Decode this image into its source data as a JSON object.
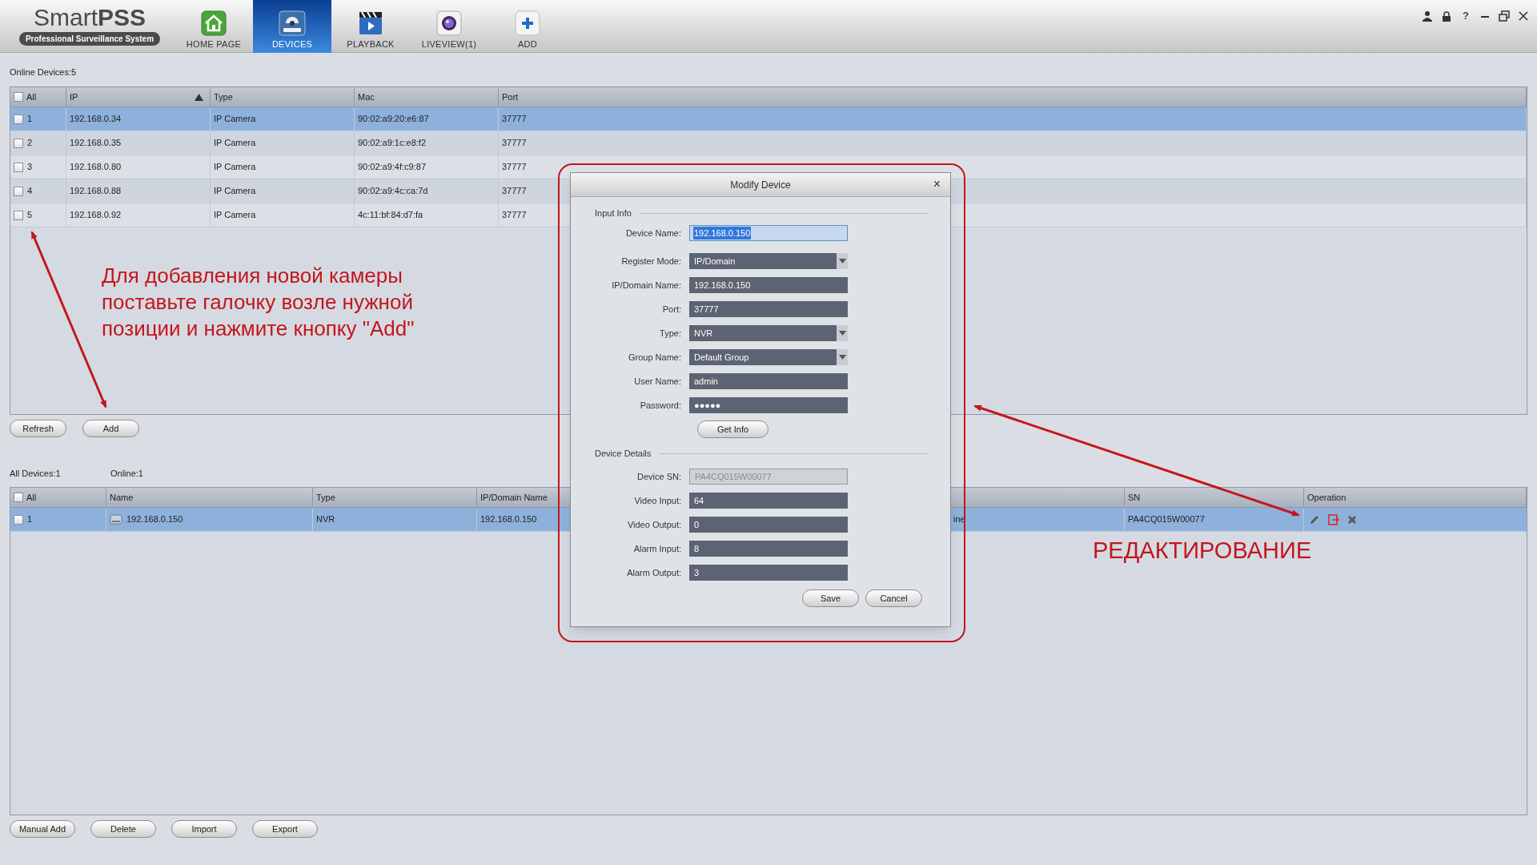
{
  "app": {
    "logo": "Smart**PSS**",
    "subtitle": "Professional Surveillance System",
    "help_button": "?"
  },
  "nav_tabs": [
    {
      "label": "HOME PAGE",
      "kind": "home",
      "selected": false
    },
    {
      "label": "DEVICES",
      "kind": "devices",
      "selected": true
    },
    {
      "label": "PLAYBACK",
      "kind": "playback",
      "selected": false
    },
    {
      "label": "LIVEVIEW(1)",
      "kind": "liveview",
      "selected": false
    },
    {
      "label": "ADD",
      "kind": "add",
      "selected": false
    }
  ],
  "online_devices": {
    "title": "Online Devices:5",
    "all_checked": false,
    "columns": [
      {
        "label": "All",
        "sorted": false
      },
      {
        "label": "IP",
        "sorted": true
      },
      {
        "label": "Type",
        "sorted": false
      },
      {
        "label": "Mac",
        "sorted": false
      },
      {
        "label": "Port",
        "sorted": false
      }
    ],
    "rows": [
      {
        "cells": [
          "1",
          "192.168.0.34",
          "IP Camera",
          "90:02:a9:20:e6:87",
          "37777"
        ],
        "checked": false,
        "selected": true
      },
      {
        "cells": [
          "2",
          "192.168.0.35",
          "IP Camera",
          "90:02:a9:1c:e8:f2",
          "37777"
        ],
        "checked": false,
        "selected": false
      },
      {
        "cells": [
          "3",
          "192.168.0.80",
          "IP Camera",
          "90:02:a9:4f:c9:87",
          "37777"
        ],
        "checked": false,
        "selected": false
      },
      {
        "cells": [
          "4",
          "192.168.0.88",
          "IP Camera",
          "90:02:a9:4c:ca:7d",
          "37777"
        ],
        "checked": false,
        "selected": false
      },
      {
        "cells": [
          "5",
          "192.168.0.92",
          "IP Camera",
          "4c:11:bf:84:d7:fa",
          "37777"
        ],
        "checked": false,
        "selected": false
      }
    ],
    "buttons": [
      "Refresh",
      "Add"
    ]
  },
  "all_devices": {
    "title": "All Devices:1",
    "online": "Online:1",
    "all_checked": false,
    "columns": [
      {
        "label": "All"
      },
      {
        "label": "Name"
      },
      {
        "label": "Type"
      },
      {
        "label": "IP/Domain Name"
      },
      {},
      {
        "label": "SN"
      },
      {
        "label": "Operation"
      }
    ],
    "rows": [
      {
        "cells": [
          "1",
          "192.168.0.150",
          "NVR",
          "192.168.0.150",
          "ine",
          "PA4CQ015W00077"
        ],
        "checked": false,
        "selected": true
      }
    ],
    "buttons": [
      "Manual Add",
      "Delete",
      "Import",
      "Export"
    ]
  },
  "dialog": {
    "title": "Modify Device",
    "close": "×",
    "input_info": {
      "title": "Input Info",
      "fields": [
        {
          "label": "Device Name:",
          "value": "192.168.0.150",
          "kind": "text",
          "focused": true
        },
        {
          "label": "Register Mode:",
          "value": "IP/Domain",
          "kind": "select",
          "focused": false
        },
        {
          "label": "IP/Domain Name:",
          "value": "192.168.0.150",
          "kind": "text",
          "focused": false
        },
        {
          "label": "Port:",
          "value": "37777",
          "kind": "text",
          "focused": false
        },
        {
          "label": "Type:",
          "value": "NVR",
          "kind": "select",
          "focused": false
        },
        {
          "label": "Group Name:",
          "value": "Default Group",
          "kind": "select",
          "focused": false
        },
        {
          "label": "User Name:",
          "value": "admin",
          "kind": "text",
          "focused": false
        },
        {
          "label": "Password:",
          "value": "●●●●●",
          "kind": "text",
          "focused": false
        }
      ]
    },
    "get_info_button": "Get Info",
    "device_details": {
      "title": "Device Details",
      "fields": [
        {
          "label": "Device SN:",
          "value": "PA4CQ015W00077",
          "kind": "readonly",
          "focused": false
        },
        {
          "label": "Video Input:",
          "value": "64",
          "kind": "text",
          "focused": false
        },
        {
          "label": "Video Output:",
          "value": "0",
          "kind": "text",
          "focused": false
        },
        {
          "label": "Alarm Input:",
          "value": "8",
          "kind": "text",
          "focused": false
        },
        {
          "label": "Alarm Output:",
          "value": "3",
          "kind": "text",
          "focused": false
        }
      ]
    },
    "buttons": [
      "Save",
      "Cancel"
    ]
  },
  "annotations": {
    "add_hint": "Для добавления новой камеры\nпоставьте галочку возле нужной\nпозиции и нажмите кнопку \"Add\"",
    "edit_hint": "РЕДАКТИРОВАНИЕ"
  }
}
